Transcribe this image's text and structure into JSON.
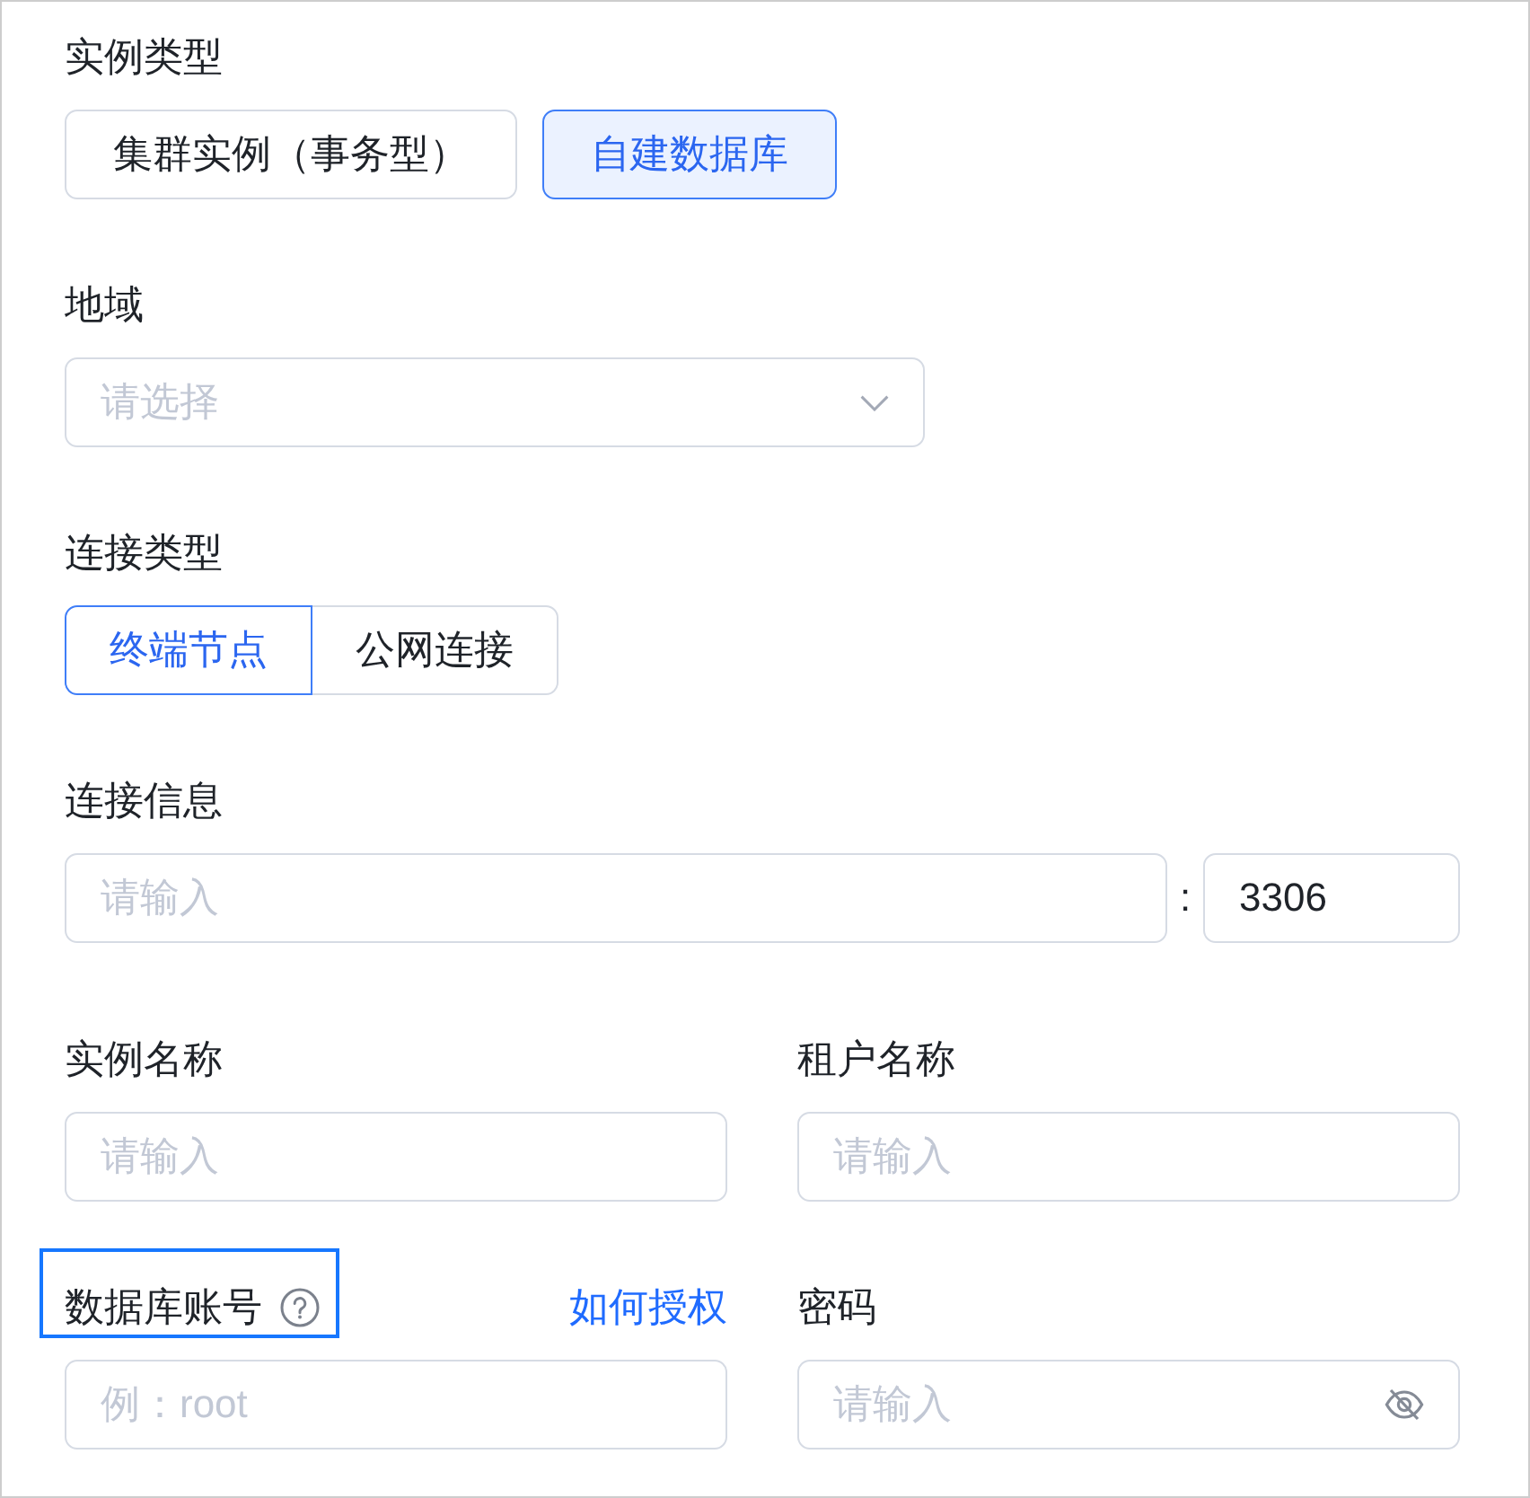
{
  "sections": [
    {
      "kind": "choice-cards",
      "label": "实例类型",
      "options": [
        {
          "label": "集群实例（事务型）",
          "selected": false
        },
        {
          "label": "自建数据库",
          "selected": true
        }
      ]
    },
    {
      "kind": "select",
      "label": "地域",
      "placeholder": "请选择"
    },
    {
      "kind": "segmented",
      "label": "连接类型",
      "options": [
        {
          "label": "终端节点",
          "selected": true
        },
        {
          "label": "公网连接",
          "selected": false
        }
      ]
    },
    {
      "kind": "host-port",
      "label": "连接信息",
      "host": {
        "placeholder": "请输入"
      },
      "separator": ":",
      "port": {
        "value": "3306"
      }
    },
    {
      "kind": "pair",
      "columns": [
        {
          "label": "实例名称",
          "help": false,
          "highlighted": false,
          "input": {
            "kind": "text",
            "placeholder": "请输入"
          }
        },
        {
          "label": "租户名称",
          "help": false,
          "highlighted": false,
          "input": {
            "kind": "text",
            "placeholder": "请输入"
          }
        }
      ]
    },
    {
      "kind": "pair",
      "columns": [
        {
          "label": "数据库账号",
          "help": true,
          "highlighted": true,
          "link": "如何授权",
          "input": {
            "kind": "text",
            "placeholder": "例：root"
          }
        },
        {
          "label": "密码",
          "help": false,
          "highlighted": false,
          "input": {
            "kind": "password",
            "placeholder": "请输入"
          }
        }
      ]
    }
  ]
}
